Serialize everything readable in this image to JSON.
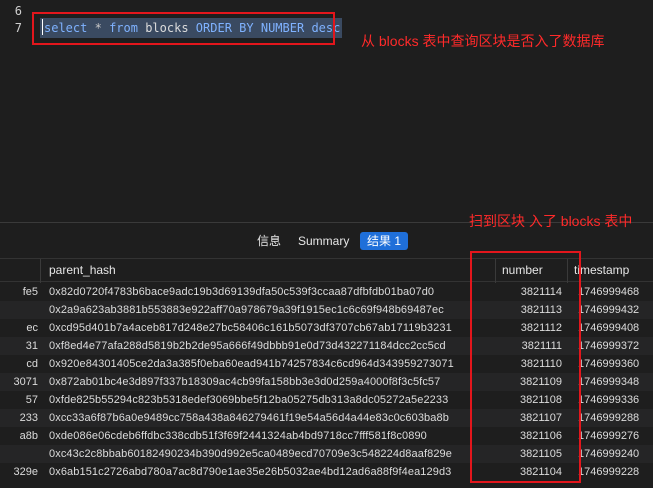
{
  "editor": {
    "lines": [
      {
        "number": "6",
        "text": ""
      },
      {
        "number": "7",
        "text": "select * from blocks ORDER BY NUMBER desc"
      }
    ],
    "sql_tokens": {
      "select": "select",
      "star": "*",
      "from": "from",
      "table": "blocks",
      "order": "ORDER",
      "by": "BY",
      "col": "NUMBER",
      "desc": "desc"
    }
  },
  "annotations": {
    "top_note": "从 blocks 表中查询区块是否入了数据库",
    "bottom_note": "扫到区块 入了 blocks 表中",
    "color": "#e3161c"
  },
  "tabs": [
    {
      "label": "信息"
    },
    {
      "label": "Summary"
    },
    {
      "label": "结果 1",
      "active": true
    }
  ],
  "table": {
    "columns": [
      "parent_hash",
      "number",
      "timestamp"
    ],
    "rows": [
      {
        "left": "fe5",
        "parent_hash": "0x82d0720f4783b6bace9adc19b3d69139dfa50c539f3ccaa87dfbfdb01ba07d0",
        "number": "3821114",
        "timestamp": "1746999468"
      },
      {
        "left": "",
        "parent_hash": "0x2a9a623ab3881b553883e922aff70a978679a39f1915ec1c6c69f948b69487ec",
        "number": "3821113",
        "timestamp": "1746999432"
      },
      {
        "left": "ec",
        "parent_hash": "0xcd95d401b7a4aceb817d248e27bc58406c161b5073df3707cb67ab17119b3231",
        "number": "3821112",
        "timestamp": "1746999408"
      },
      {
        "left": "31",
        "parent_hash": "0xf8ed4e77afa288d5819b2b2de95a666f49dbbb91e0d73d432271184dcc2cc5cd",
        "number": "3821111",
        "timestamp": "1746999372"
      },
      {
        "left": "cd",
        "parent_hash": "0x920e84301405ce2da3a385f0eba60ead941b74257834c6cd964d343959273071",
        "number": "3821110",
        "timestamp": "1746999360"
      },
      {
        "left": "3071",
        "parent_hash": "0x872ab01bc4e3d897f337b18309ac4cb99fa158bb3e3d0d259a4000f8f3c5fc57",
        "number": "3821109",
        "timestamp": "1746999348"
      },
      {
        "left": "57",
        "parent_hash": "0xfde825b55294c823b5318edef3069bbe5f12ba05275db313a8dc05272a5e2233",
        "number": "3821108",
        "timestamp": "1746999336"
      },
      {
        "left": "233",
        "parent_hash": "0xcc33a6f87b6a0e9489cc758a438a846279461f19e54a56d4a44e83c0c603ba8b",
        "number": "3821107",
        "timestamp": "1746999288"
      },
      {
        "left": "a8b",
        "parent_hash": "0xde086e06cdeb6ffdbc338cdb51f3f69f2441324ab4bd9718cc7fff581f8c0890",
        "number": "3821106",
        "timestamp": "1746999276"
      },
      {
        "left": "",
        "parent_hash": "0xc43c2c8bbab60182490234b390d992e5ca0489ecd70709e3c548224d8aaf829e",
        "number": "3821105",
        "timestamp": "1746999240"
      },
      {
        "left": "329e",
        "parent_hash": "0x6ab151c2726abd780a7ac8d790e1ae35e26b5032ae4bd12ad6a88f9f4ea129d3",
        "number": "3821104",
        "timestamp": "1746999228"
      }
    ]
  }
}
